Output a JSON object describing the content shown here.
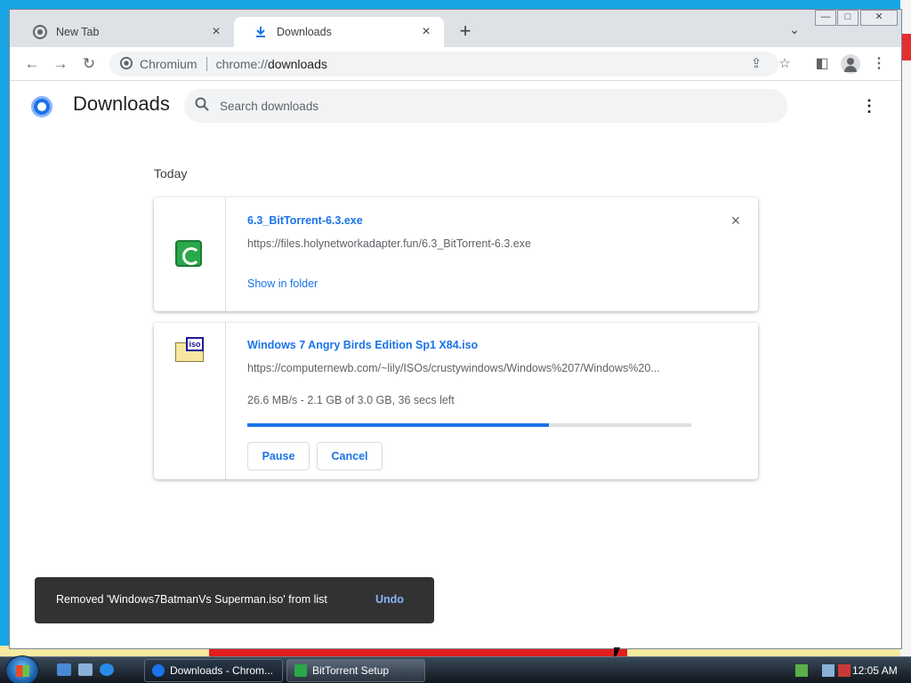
{
  "browser": {
    "tabs": [
      {
        "title": "New Tab",
        "active": false
      },
      {
        "title": "Downloads",
        "active": true
      }
    ],
    "new_tab_label": "+",
    "omnibox": {
      "site_name": "Chromium",
      "scheme": "chrome://",
      "path": "downloads"
    },
    "window_controls": {
      "minimize": "—",
      "maximize": "□",
      "close": "✕"
    }
  },
  "page": {
    "title": "Downloads",
    "search": {
      "placeholder": "Search downloads",
      "value": ""
    },
    "date_heading": "Today",
    "downloads": [
      {
        "file_name": "6.3_BitTorrent-6.3.exe",
        "url": "https://files.holynetworkadapter.fun/6.3_BitTorrent-6.3.exe",
        "link": "Show in folder",
        "icon": "bittorrent-icon"
      },
      {
        "file_name": "Windows 7 Angry Birds Edition Sp1 X84.iso",
        "url": "https://computernewb.com/~lily/ISOs/crustywindows/Windows%207/Windows%20...",
        "status": "26.6 MB/s - 2.1 GB of 3.0 GB, 36 secs left",
        "progress": 0.68,
        "pause_label": "Pause",
        "cancel_label": "Cancel",
        "icon": "iso-file-icon",
        "icon_tag": "iso"
      }
    ],
    "snackbar": {
      "message": "Removed 'Windows7BatmanVs Superman.iso' from list",
      "action": "Undo"
    }
  },
  "taskbar": {
    "tasks": [
      {
        "label": "Downloads - Chrom...",
        "active": true
      },
      {
        "label": "BitTorrent Setup",
        "active": false
      }
    ],
    "clock": "12:05 AM"
  },
  "colors": {
    "accent": "#1a73e8",
    "snackbar_bg": "#323232",
    "snackbar_action": "#8ab4f8"
  }
}
